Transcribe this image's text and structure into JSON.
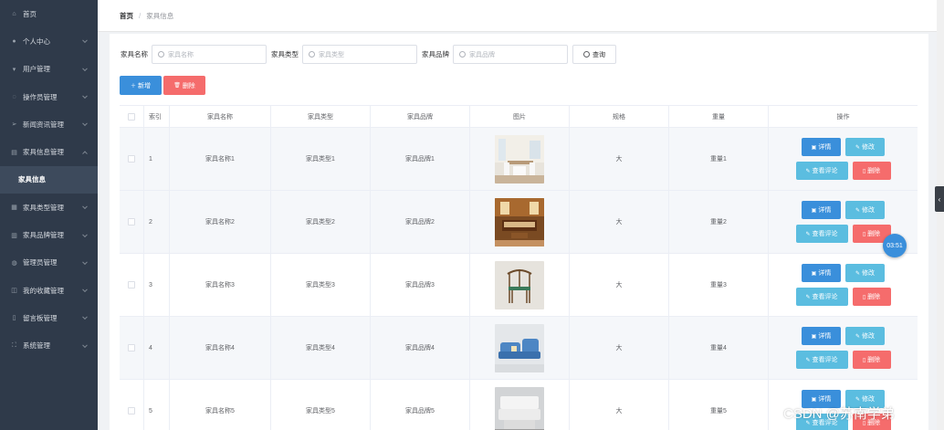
{
  "sidebar": {
    "items": [
      {
        "label": "首页",
        "icon": "home-icon",
        "chevron": "none"
      },
      {
        "label": "个人中心",
        "icon": "user-icon",
        "chevron": "down"
      },
      {
        "label": "用户管理",
        "icon": "users-icon",
        "chevron": "down"
      },
      {
        "label": "操作员管理",
        "icon": "operator-icon",
        "chevron": "down"
      },
      {
        "label": "新闻资讯管理",
        "icon": "send-icon",
        "chevron": "down"
      },
      {
        "label": "家具信息管理",
        "icon": "furniture-icon",
        "chevron": "up"
      },
      {
        "label": "家具信息",
        "icon": "",
        "chevron": "none",
        "sub": true
      },
      {
        "label": "家具类型管理",
        "icon": "list-icon",
        "chevron": "down"
      },
      {
        "label": "家具品牌管理",
        "icon": "brand-icon",
        "chevron": "down"
      },
      {
        "label": "管理员管理",
        "icon": "admin-icon",
        "chevron": "down"
      },
      {
        "label": "我的收藏管理",
        "icon": "star-icon",
        "chevron": "down"
      },
      {
        "label": "留言板管理",
        "icon": "message-icon",
        "chevron": "down"
      },
      {
        "label": "系统管理",
        "icon": "system-icon",
        "chevron": "down"
      }
    ]
  },
  "breadcrumb": {
    "home": "首页",
    "sep": "/",
    "current": "家具信息"
  },
  "search": {
    "name_label": "家具名称",
    "name_placeholder": "家具名称",
    "type_label": "家具类型",
    "type_placeholder": "家具类型",
    "brand_label": "家具品牌",
    "brand_placeholder": "家具品牌",
    "query_label": "查询"
  },
  "actions": {
    "add_label": "新增",
    "delete_label": "删除"
  },
  "table": {
    "headers": [
      "索引",
      "家具名称",
      "家具类型",
      "家具品牌",
      "图片",
      "规格",
      "重量",
      "操作"
    ],
    "rows": [
      {
        "index": "1",
        "name": "家具名称1",
        "type": "家具类型1",
        "brand": "家具品牌1",
        "spec": "大",
        "weight": "重量1",
        "image": "dining-room-photo"
      },
      {
        "index": "2",
        "name": "家具名称2",
        "type": "家具类型2",
        "brand": "家具品牌2",
        "spec": "大",
        "weight": "重量2",
        "image": "wooden-sofa-photo"
      },
      {
        "index": "3",
        "name": "家具名称3",
        "type": "家具类型3",
        "brand": "家具品牌3",
        "spec": "大",
        "weight": "重量3",
        "image": "chair-photo"
      },
      {
        "index": "4",
        "name": "家具名称4",
        "type": "家具类型4",
        "brand": "家具品牌4",
        "spec": "大",
        "weight": "重量4",
        "image": "blue-sofa-photo"
      },
      {
        "index": "5",
        "name": "家具名称5",
        "type": "家具类型5",
        "brand": "家具品牌5",
        "spec": "大",
        "weight": "重量5",
        "image": "white-sofa-photo"
      }
    ],
    "ops": {
      "detail": "详情",
      "edit": "修改",
      "review": "查看评论",
      "remove": "删除"
    }
  },
  "timer": "03:51",
  "watermark": "CSDN @苏南学弟",
  "colors": {
    "sidebar_bg": "#2f3a4a",
    "primary": "#3a8fdb",
    "info": "#5bbde0",
    "danger": "#f56c6c"
  }
}
